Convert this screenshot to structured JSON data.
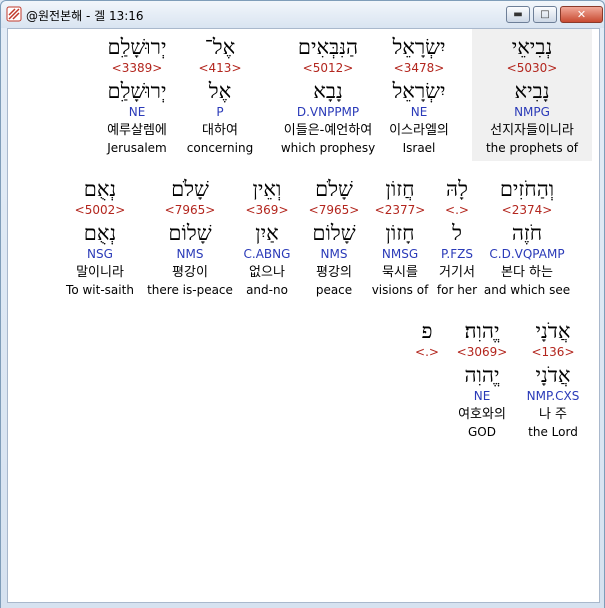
{
  "window": {
    "title": "@원전본해 - 겔 13:16",
    "minimize_glyph": "▬",
    "maximize_glyph": "□",
    "close_glyph": "✕"
  },
  "rows": [
    {
      "words": [
        {
          "hebrew": "נְבִיאֵי",
          "strong": "<5030>",
          "lemma": "נָבִיא",
          "morph": "NMPG",
          "korean": "선지자들이니라",
          "english": "the prophets of",
          "selected": true
        },
        {
          "hebrew": "יִשְׂרָאֵל",
          "strong": "<3478>",
          "lemma": "יִשְׂרָאֵל",
          "morph": "NE",
          "korean": "이스라엘의",
          "english": "Israel"
        },
        {
          "hebrew": "הַנִּבְּאִים",
          "strong": "<5012>",
          "lemma": "נָבָא",
          "morph": "D.VNPPMP",
          "korean": "이들은-예언하여",
          "english": "which prophesy"
        },
        {
          "hebrew": "אֶל־",
          "strong": "<413>",
          "lemma": "אֶל",
          "morph": "P",
          "korean": "대하여",
          "english": "concerning"
        },
        {
          "hebrew": "יְרוּשָׁלִַם",
          "strong": "<3389>",
          "lemma": "יְרוּשָׁלַ͏ִם",
          "morph": "NE",
          "korean": "예루살렘에",
          "english": "Jerusalem"
        }
      ]
    },
    {
      "words": [
        {
          "hebrew": "וְהַחֹזִים",
          "strong": "<2374>",
          "lemma": "חֹזֶה",
          "morph": "C.D.VQPAMP",
          "korean": "본다 하는",
          "english": "and which see"
        },
        {
          "hebrew": "לָהּ",
          "strong": "<.>",
          "lemma": "ל",
          "morph": "P.FZS",
          "korean": "거기서",
          "english": "for her"
        },
        {
          "hebrew": "חֲזוֹן",
          "strong": "<2377>",
          "lemma": "חָזוֹן",
          "morph": "NMSG",
          "korean": "묵시를",
          "english": "visions of"
        },
        {
          "hebrew": "שָׁלֹם",
          "strong": "<7965>",
          "lemma": "שָׁלוֹם",
          "morph": "NMS",
          "korean": "평강의",
          "english": "peace"
        },
        {
          "hebrew": "וְאֵין",
          "strong": "<369>",
          "lemma": "אַיִן",
          "morph": "C.ABNG",
          "korean": "없으나",
          "english": "and-no"
        },
        {
          "hebrew": "שָׁלֹם",
          "strong": "<7965>",
          "lemma": "שָׁלוֹם",
          "morph": "NMS",
          "korean": "평강이",
          "english": "there is-peace"
        },
        {
          "hebrew": "נְאֻם",
          "strong": "<5002>",
          "lemma": "נְאֻם",
          "morph": "NSG",
          "korean": "말이니라",
          "english": "To wit-saith"
        }
      ]
    },
    {
      "words": [
        {
          "hebrew": "אֲדֹנָי",
          "strong": "<136>",
          "lemma": "אֲדֹנָי",
          "morph": "NMP.CXS",
          "korean": "나 주",
          "english": "the Lord"
        },
        {
          "hebrew": "יֱהוִה׃",
          "strong": "<3069>",
          "lemma": "יֱהוִה",
          "morph": "NE",
          "korean": "여호와의",
          "english": "GOD"
        },
        {
          "hebrew": "פ",
          "strong": "<.>",
          "lemma": "",
          "morph": "",
          "korean": "",
          "english": ""
        }
      ]
    }
  ]
}
